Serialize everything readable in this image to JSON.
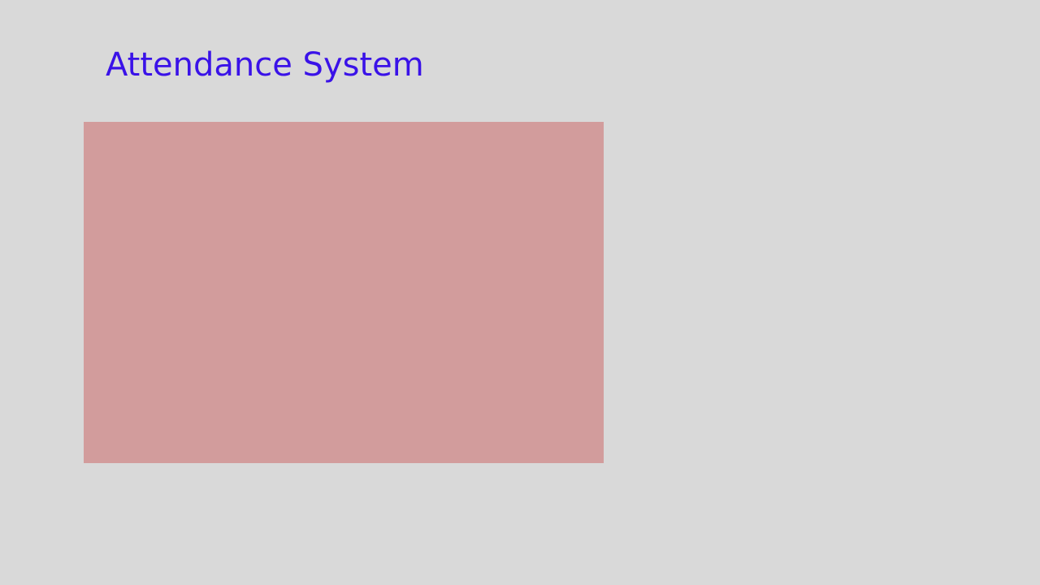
{
  "header": {
    "title": "Attendance System",
    "title_color": "#3a12e8"
  },
  "main": {
    "panel_color": "#d29c9c"
  },
  "page": {
    "background_color": "#d9d9d9"
  }
}
